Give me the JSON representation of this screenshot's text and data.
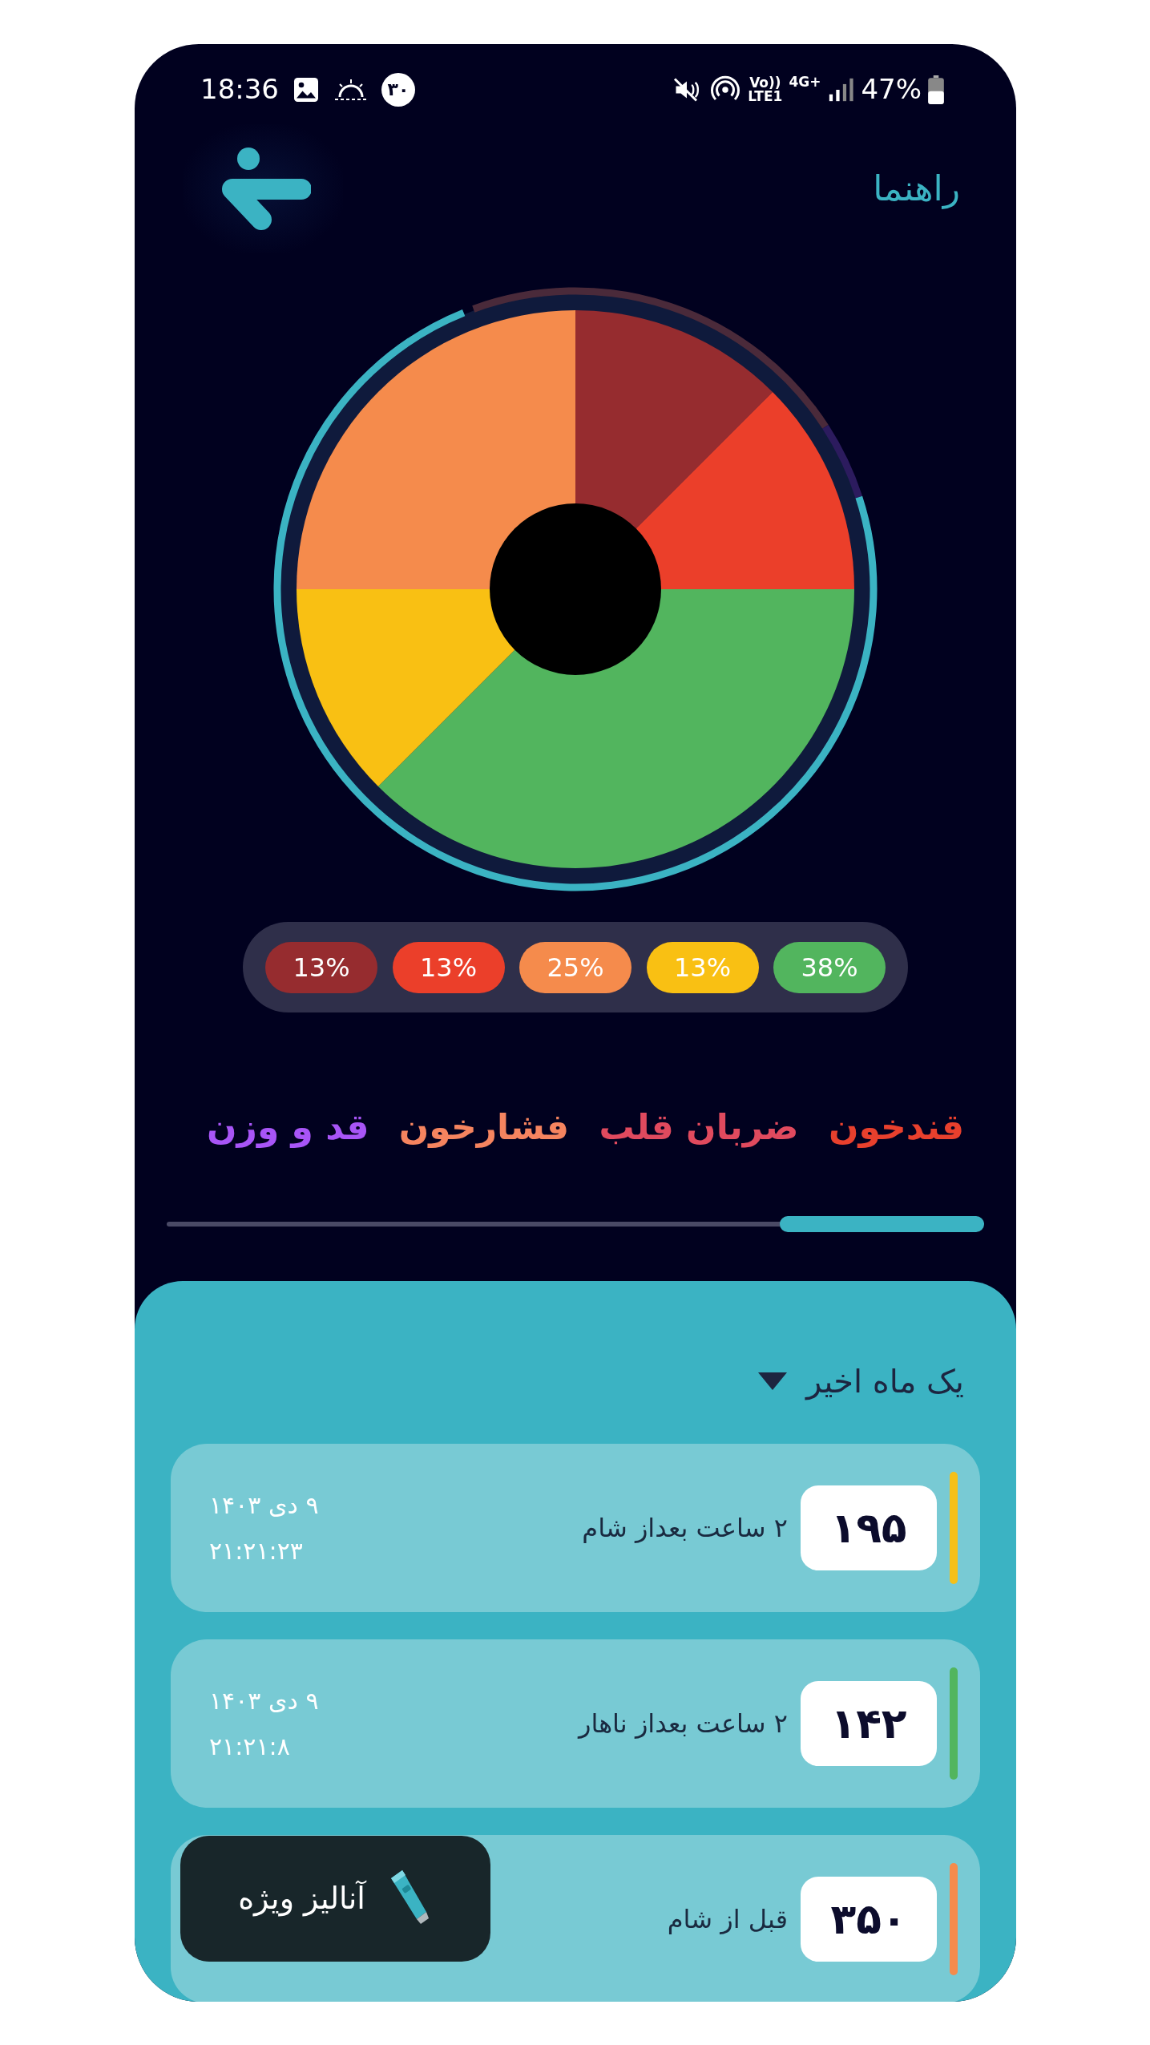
{
  "status_bar": {
    "time": "18:36",
    "badge": "۳۰",
    "volte": "Vo))",
    "lte": "LTE1",
    "network": "4G+",
    "battery": "47%"
  },
  "header": {
    "title": "راهنما"
  },
  "chart": {
    "chart_data": {
      "type": "donut",
      "values": [
        12.5,
        12.5,
        37.5,
        12.5,
        25
      ],
      "colors": [
        "#962c2f",
        "#eb3f2a",
        "#52b55e",
        "#f9c013",
        "#f58b4c"
      ]
    }
  },
  "legend": [
    {
      "text": "38%",
      "color": "#52b55e"
    },
    {
      "text": "13%",
      "color": "#f9c013"
    },
    {
      "text": "25%",
      "color": "#f58b4c"
    },
    {
      "text": "13%",
      "color": "#eb3f2a"
    },
    {
      "text": "13%",
      "color": "#962c2f"
    }
  ],
  "tabs": [
    {
      "label": "قندخون",
      "color": "#e8402d",
      "selected": true
    },
    {
      "label": "ضربان قلب",
      "color": "#e04a5e",
      "selected": false
    },
    {
      "label": "فشارخون",
      "color": "#f5845f",
      "selected": false
    },
    {
      "label": "قد و وزن",
      "color": "#a855f7",
      "selected": false
    }
  ],
  "period": {
    "label": "یک ماه اخیر"
  },
  "readings": [
    {
      "value": "۱۹۵",
      "label": "۲ ساعت بعداز شام",
      "date": "۹ دی ۱۴۰۳",
      "time": "۲۱:۲۱:۲۳",
      "color": "#f5c018"
    },
    {
      "value": "۱۴۲",
      "label": "۲ ساعت بعداز ناهار",
      "date": "۹ دی ۱۴۰۳",
      "time": "۲۱:۲۱:۸",
      "color": "#52b55e"
    },
    {
      "value": "۳۵۰",
      "label": "قبل از شام",
      "color": "#f58b4c"
    }
  ],
  "fab": {
    "label": "آنالیز ویژه"
  }
}
